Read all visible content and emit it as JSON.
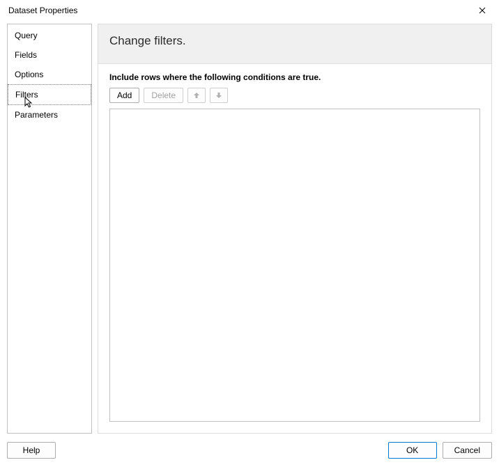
{
  "dialog": {
    "title": "Dataset Properties"
  },
  "sidebar": {
    "items": [
      {
        "label": "Query"
      },
      {
        "label": "Fields"
      },
      {
        "label": "Options"
      },
      {
        "label": "Filters"
      },
      {
        "label": "Parameters"
      }
    ],
    "selected_index": 3
  },
  "main": {
    "title": "Change filters.",
    "instruction": "Include rows where the following conditions are true.",
    "toolbar": {
      "add_label": "Add",
      "delete_label": "Delete"
    }
  },
  "footer": {
    "help_label": "Help",
    "ok_label": "OK",
    "cancel_label": "Cancel"
  }
}
